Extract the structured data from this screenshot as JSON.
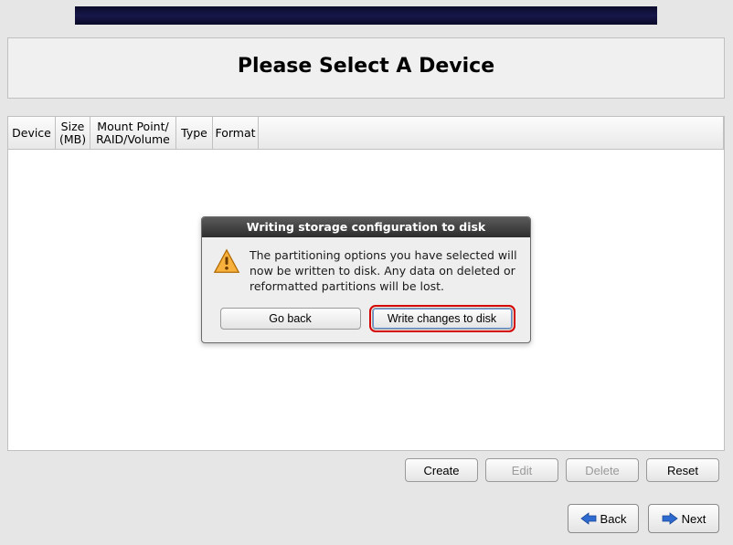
{
  "page": {
    "title": "Please Select A Device"
  },
  "table": {
    "columns": {
      "device": "Device",
      "size": "Size (MB)",
      "mount": "Mount Point/ RAID/Volume",
      "type": "Type",
      "format": "Format"
    }
  },
  "actions": {
    "create": "Create",
    "edit": "Edit",
    "delete": "Delete",
    "reset": "Reset"
  },
  "nav": {
    "back": "Back",
    "next": "Next"
  },
  "dialog": {
    "title": "Writing storage configuration to disk",
    "message": "The partitioning options you have selected will now be written to disk.  Any data on deleted or reformatted partitions will be lost.",
    "go_back": "Go back",
    "write": "Write changes to disk"
  }
}
